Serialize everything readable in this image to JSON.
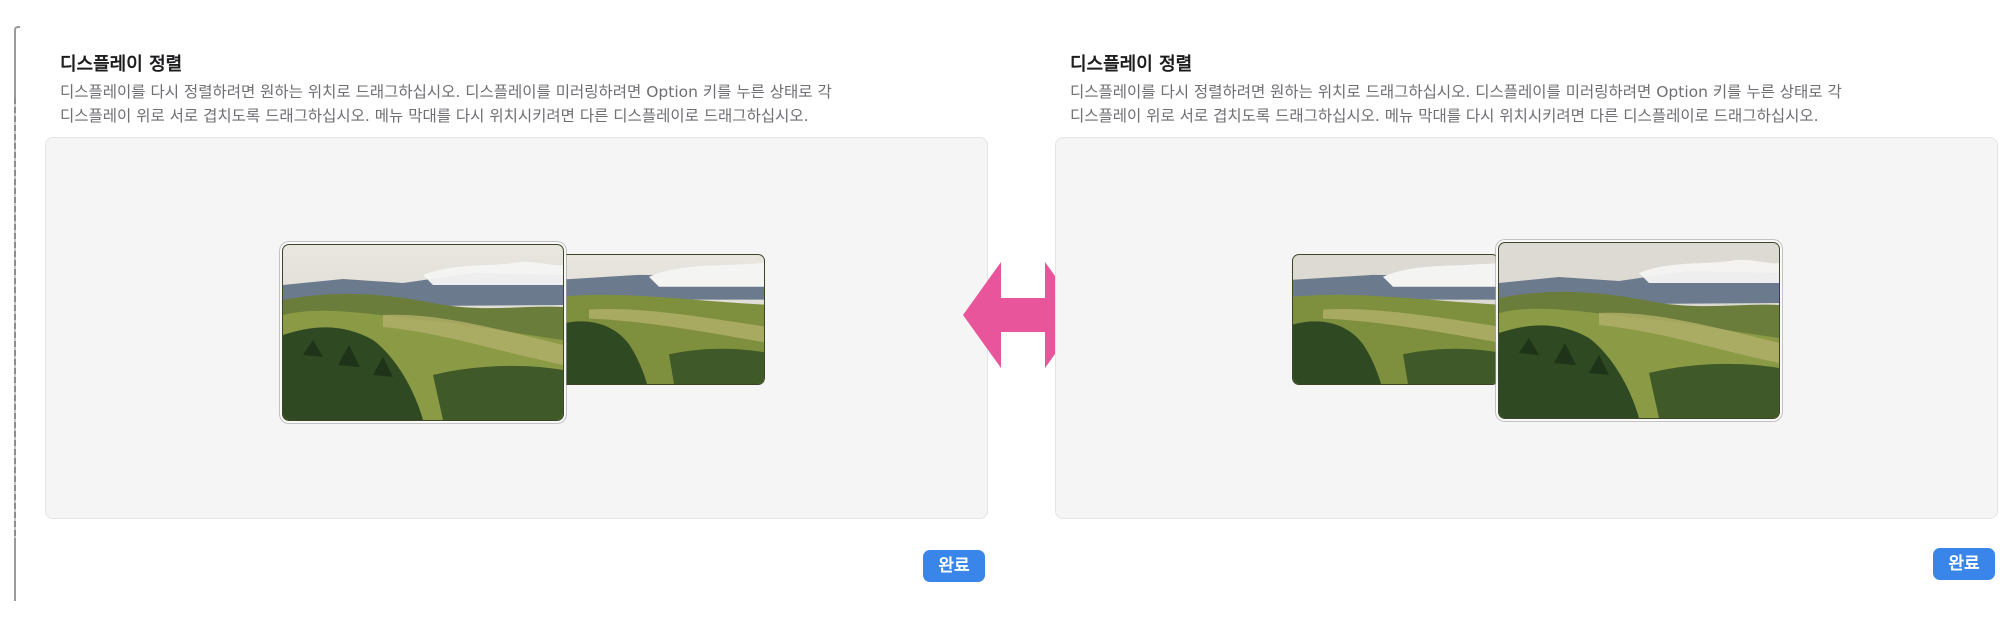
{
  "left_panel": {
    "title": "디스플레이 정렬",
    "description_line1": "디스플레이를 다시 정렬하려면 원하는 위치로 드래그하십시오. 디스플레이를 미러링하려면 Option 키를 누른 상태로 각",
    "description_line2": "디스플레이 위로 서로 겹치도록 드래그하십시오. 메뉴 막대를 다시 위치시키려면 다른 디스플레이로 드래그하십시오.",
    "done_label": "완료",
    "main_display_position": "left"
  },
  "right_panel": {
    "title": "디스플레이 정렬",
    "description_line1": "디스플레이를 다시 정렬하려면 원하는 위치로 드래그하십시오. 디스플레이를 미러링하려면 Option 키를 누른 상태로 각",
    "description_line2": "디스플레이 위로 서로 겹치도록 드래그하십시오. 메뉴 막대를 다시 위치시키려면 다른 디스플레이로 드래그하십시오.",
    "done_label": "완료",
    "main_display_position": "right"
  },
  "swap_arrow": {
    "icon": "double-headed-arrow-icon",
    "color": "#e8559a"
  },
  "colors": {
    "accent": "#3a85ea",
    "arrangement_background": "#f5f5f5"
  }
}
